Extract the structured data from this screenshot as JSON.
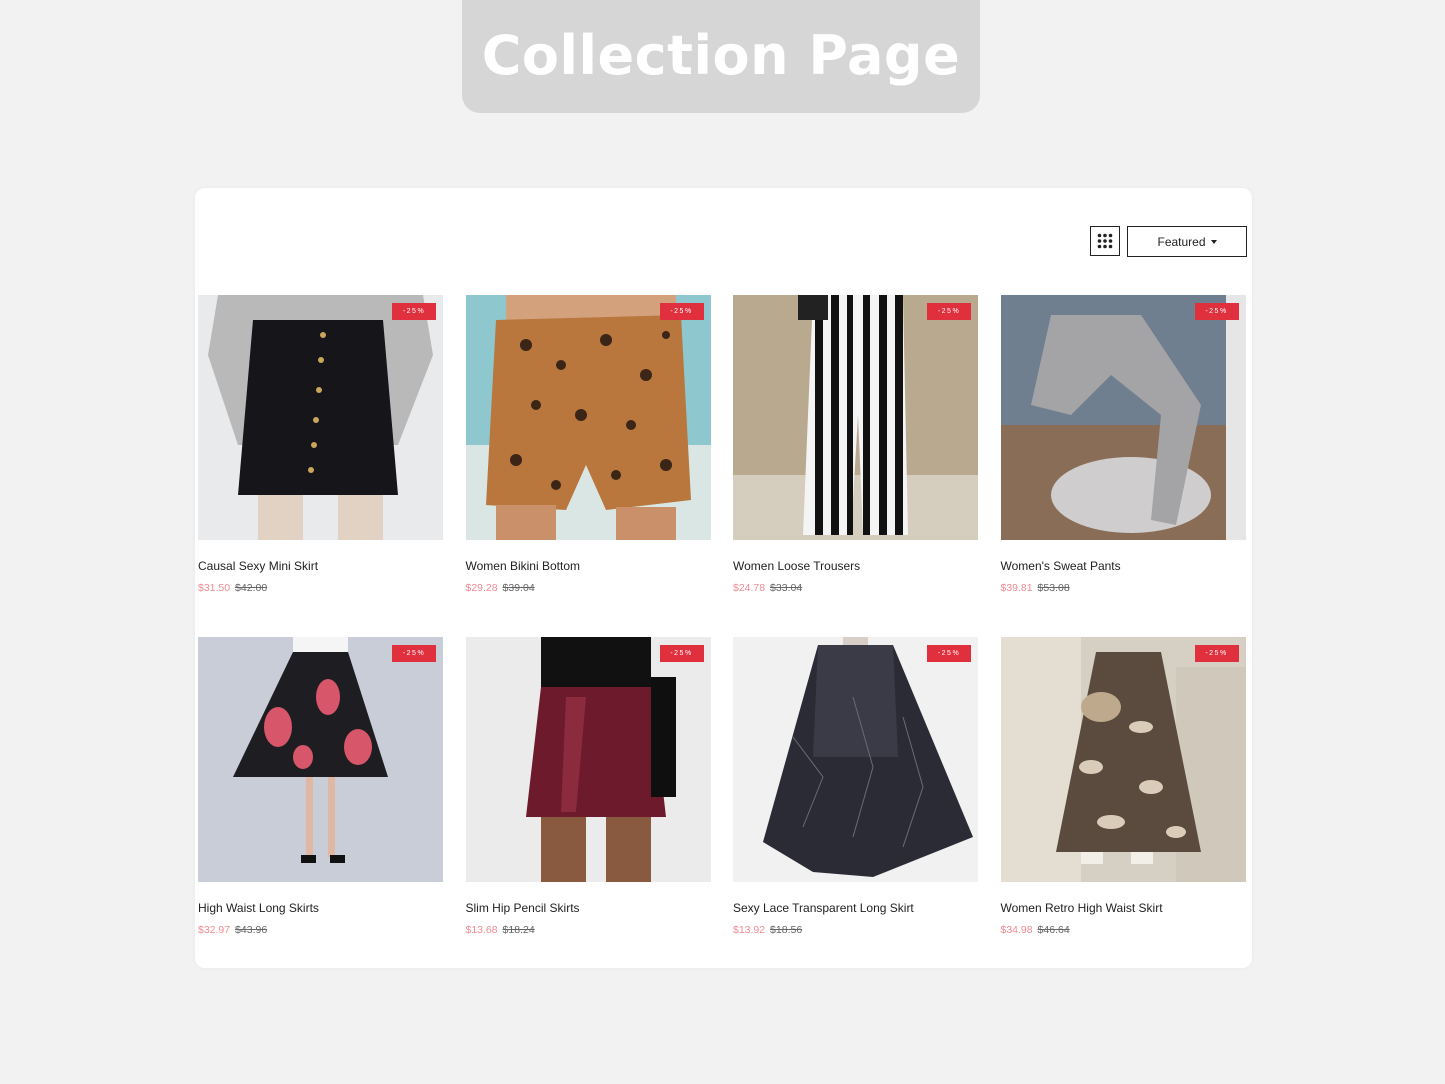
{
  "banner": {
    "title": "Collection Page"
  },
  "toolbar": {
    "sort_label": "Featured",
    "grid_icon": "grid-icon"
  },
  "colors": {
    "sale_price": "#f08a93",
    "badge_bg": "#e0303e",
    "banner_bg": "#d6d6d6"
  },
  "products": [
    {
      "name": "Causal Sexy Mini Skirt",
      "sale_price": "$31.50",
      "original_price": "$42.00",
      "badge": "-25%"
    },
    {
      "name": "Women Bikini Bottom",
      "sale_price": "$29.28",
      "original_price": "$39.04",
      "badge": "-25%"
    },
    {
      "name": "Women Loose Trousers",
      "sale_price": "$24.78",
      "original_price": "$33.04",
      "badge": "-25%"
    },
    {
      "name": "Women's Sweat Pants",
      "sale_price": "$39.81",
      "original_price": "$53.08",
      "badge": "-25%"
    },
    {
      "name": "High Waist Long Skirts",
      "sale_price": "$32.97",
      "original_price": "$43.96",
      "badge": "-25%"
    },
    {
      "name": "Slim Hip Pencil Skirts",
      "sale_price": "$13.68",
      "original_price": "$18.24",
      "badge": "-25%"
    },
    {
      "name": "Sexy Lace Transparent Long Skirt",
      "sale_price": "$13.92",
      "original_price": "$18.56",
      "badge": "-25%"
    },
    {
      "name": "Women Retro High Waist Skirt",
      "sale_price": "$34.98",
      "original_price": "$46.64",
      "badge": "-25%"
    }
  ]
}
